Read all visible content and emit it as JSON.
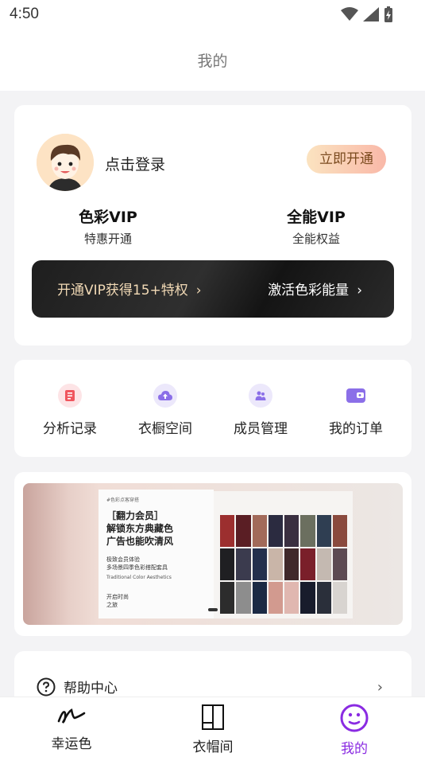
{
  "status": {
    "time": "4:50"
  },
  "nav": {
    "title": "我的"
  },
  "user": {
    "login_label": "点击登录",
    "open_button": "立即开通"
  },
  "vip": {
    "color": {
      "title": "色彩VIP",
      "subtitle": "特惠开通"
    },
    "all": {
      "title": "全能VIP",
      "subtitle": "全能权益"
    }
  },
  "banner": {
    "left_text": "开通VIP获得15+特权",
    "right_text": "激活色彩能量"
  },
  "tools": [
    {
      "label": "分析记录",
      "icon": "record-icon"
    },
    {
      "label": "衣橱空间",
      "icon": "cloud-upload-icon"
    },
    {
      "label": "成员管理",
      "icon": "members-icon"
    },
    {
      "label": "我的订单",
      "icon": "wallet-icon"
    }
  ],
  "promo": {
    "small": "#色彩点客穿搭",
    "head1": "［翻力会员］",
    "head2": "解锁东方典藏色",
    "head3": "广告也能吹清风",
    "sub1": "极致会员体验",
    "sub2": "多场景四季色彩搭配套具",
    "en": "Traditional Color Aesthetics",
    "bottom1": "开启时尚",
    "bottom2": "之旅"
  },
  "help": {
    "label": "帮助中心"
  },
  "tabbar": [
    {
      "label": "幸运色",
      "icon": "signature-icon"
    },
    {
      "label": "衣帽间",
      "icon": "wardrobe-icon"
    },
    {
      "label": "我的",
      "icon": "smile-icon"
    }
  ],
  "colors": {
    "accent": "#8a2be2",
    "gold": "#f1d9b5"
  }
}
